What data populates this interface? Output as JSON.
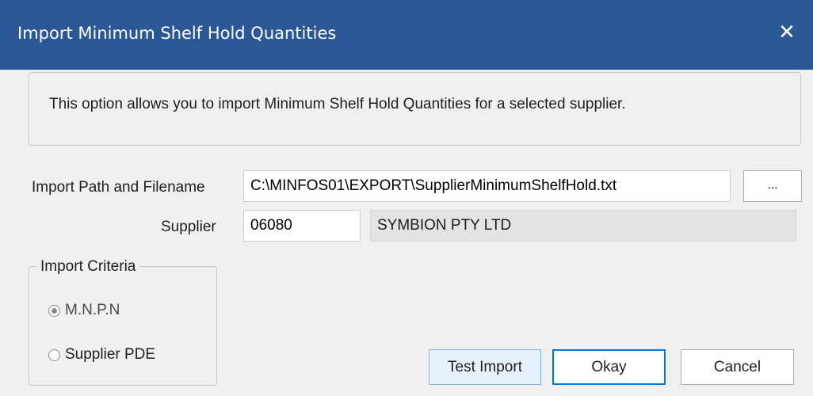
{
  "window": {
    "title": "Import Minimum Shelf Hold Quantities",
    "close_glyph": "✕"
  },
  "info": {
    "text": "This option allows you to import Minimum Shelf Hold Quantities for a selected supplier."
  },
  "import_path": {
    "label": "Import Path and Filename",
    "value": "C:\\MINFOS01\\EXPORT\\SupplierMinimumShelfHold.txt",
    "browse_label": "..."
  },
  "supplier": {
    "label": "Supplier",
    "code": "06080",
    "name": "SYMBION PTY LTD"
  },
  "criteria": {
    "legend": "Import Criteria",
    "options": [
      {
        "label": "M.N.P.N",
        "selected": true
      },
      {
        "label": "Supplier PDE",
        "selected": false
      }
    ]
  },
  "buttons": {
    "test_import": "Test Import",
    "okay": "Okay",
    "cancel": "Cancel"
  },
  "colors": {
    "titlebar": "#2b5797",
    "primary_border": "#0078d7",
    "highlight_button": "#e5f1fb"
  }
}
